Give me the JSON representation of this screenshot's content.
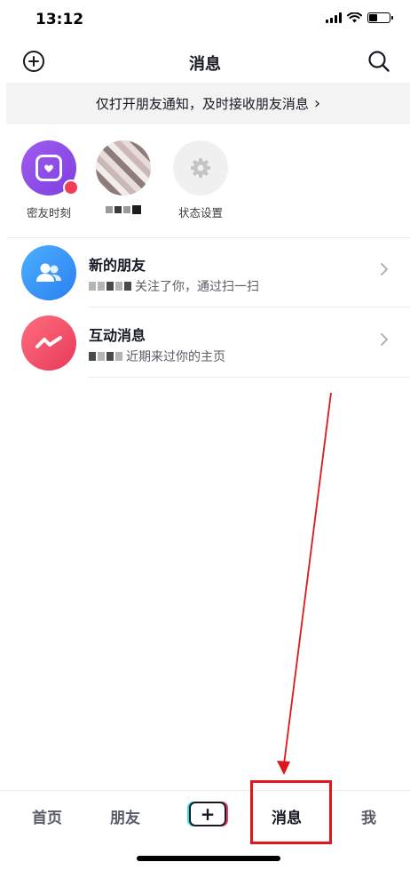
{
  "status_bar": {
    "time": "13:12"
  },
  "header": {
    "title": "消息",
    "add_icon": "plus-circle-icon",
    "search_icon": "search-icon"
  },
  "banner": {
    "text": "仅打开朋友通知，及时接收朋友消息",
    "chevron": "›"
  },
  "stories": [
    {
      "label": "密友时刻",
      "icon": "close-friends-moment-icon"
    },
    {
      "label": "",
      "icon": "pixelated-avatar"
    },
    {
      "label": "状态设置",
      "icon": "gear-icon"
    }
  ],
  "list": [
    {
      "title": "新的朋友",
      "subtitle": "关注了你，通过扫一扫",
      "icon": "friends-icon",
      "color": "#2a7ff0"
    },
    {
      "title": "互动消息",
      "subtitle": "近期来过你的主页",
      "icon": "interaction-wave-icon",
      "color": "#e73a59"
    }
  ],
  "tabbar": {
    "home": "首页",
    "friends": "朋友",
    "add_symbol": "+",
    "messages": "消息",
    "me": "我"
  },
  "annotation": {
    "color": "#e0161b"
  }
}
